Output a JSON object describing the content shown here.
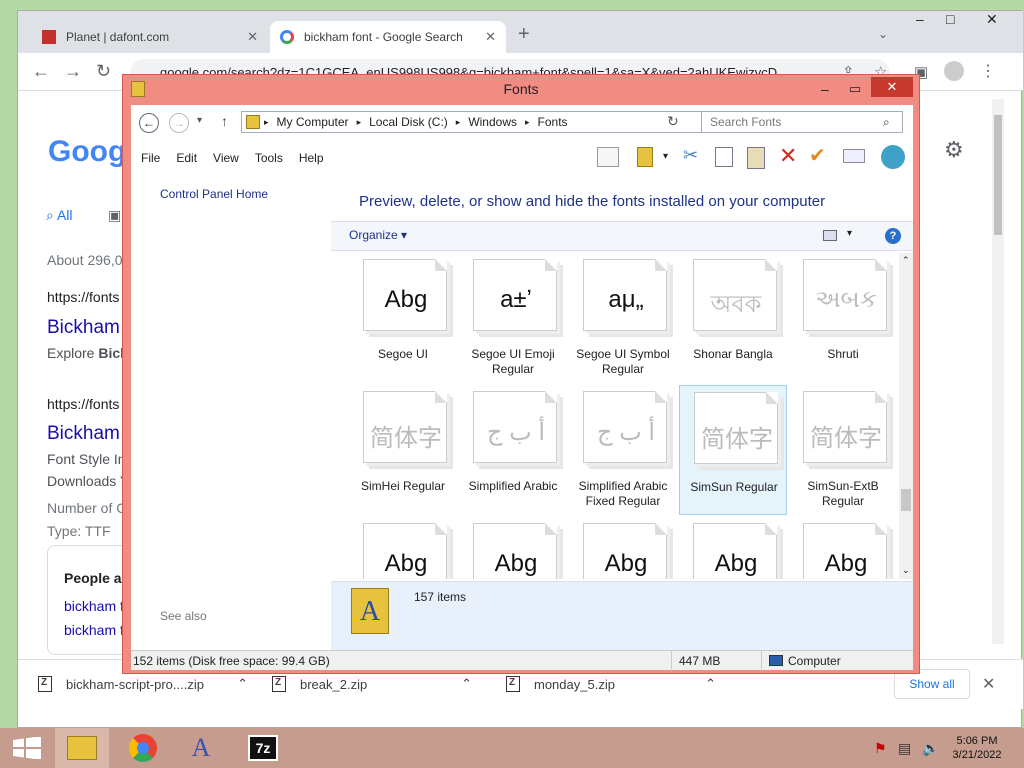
{
  "browser": {
    "tabs": [
      {
        "title": "Planet | dafont.com"
      },
      {
        "title": "bickham font - Google Search"
      }
    ],
    "new_tab": "+",
    "url": "google.com/search?dz=1C1GCEA_enUS998US998&q=bickham+font&spell=1&sa=X&ved=2ahUKEwizvcD",
    "window_controls": {
      "min": "–",
      "max": "□",
      "close": "✕"
    }
  },
  "google": {
    "logo": "Goog",
    "tab_all": "All",
    "about": "About 296,0",
    "results": [
      {
        "url": "https://fonts",
        "title": "Bickham",
        "snippet_a": "Explore ",
        "snippet_b": "Bick"
      },
      {
        "url": "https://fonts",
        "title": "Bickham",
        "line1": "Font Style In",
        "line2": "Downloads Y",
        "line3": "Number of G",
        "line4": "Type: TTF"
      }
    ],
    "people_also": "People als",
    "related": [
      "bickham f",
      "bickham f"
    ]
  },
  "downloads": {
    "items": [
      "bickham-script-pro....zip",
      "break_2.zip",
      "monday_5.zip"
    ],
    "show_all": "Show all"
  },
  "explorer": {
    "title": "Fonts",
    "breadcrumb": [
      "My Computer",
      "Local Disk (C:)",
      "Windows",
      "Fonts"
    ],
    "search_placeholder": "Search Fonts",
    "menu": [
      "File",
      "Edit",
      "View",
      "Tools",
      "Help"
    ],
    "left_link": "Control Panel Home",
    "see_also": "See also",
    "headline": "Preview, delete, or show and hide the fonts installed on your computer",
    "organize": "Organize",
    "fonts": [
      {
        "sample": "Abg",
        "name": "Segoe UI",
        "dim": false
      },
      {
        "sample": "a±ʼ",
        "name": "Segoe UI Emoji Regular",
        "dim": false
      },
      {
        "sample": "aμ„",
        "name": "Segoe UI Symbol Regular",
        "dim": false
      },
      {
        "sample": "অবক",
        "name": "Shonar Bangla",
        "dim": true
      },
      {
        "sample": "અબક",
        "name": "Shruti",
        "dim": true
      },
      {
        "sample": "简体字",
        "name": "SimHei Regular",
        "dim": true
      },
      {
        "sample": "أ ب ج",
        "name": "Simplified Arabic",
        "dim": true
      },
      {
        "sample": "أ ب ج",
        "name": "Simplified Arabic Fixed Regular",
        "dim": true
      },
      {
        "sample": "简体字",
        "name": "SimSun Regular",
        "dim": true,
        "selected": true
      },
      {
        "sample": "简体字",
        "name": "SimSun-ExtB Regular",
        "dim": true
      },
      {
        "sample": "Abg",
        "name": "",
        "dim": false
      },
      {
        "sample": "Abg",
        "name": "",
        "dim": false
      },
      {
        "sample": "Abg",
        "name": "",
        "dim": false
      },
      {
        "sample": "Abg",
        "name": "",
        "dim": false
      },
      {
        "sample": "Abg",
        "name": "",
        "dim": false
      }
    ],
    "details_count": "157 items",
    "status_items": "152 items (Disk free space: 99.4 GB)",
    "status_size": "447 MB",
    "status_location": "Computer"
  },
  "taskbar": {
    "time": "5:06 PM",
    "date": "3/21/2022"
  }
}
